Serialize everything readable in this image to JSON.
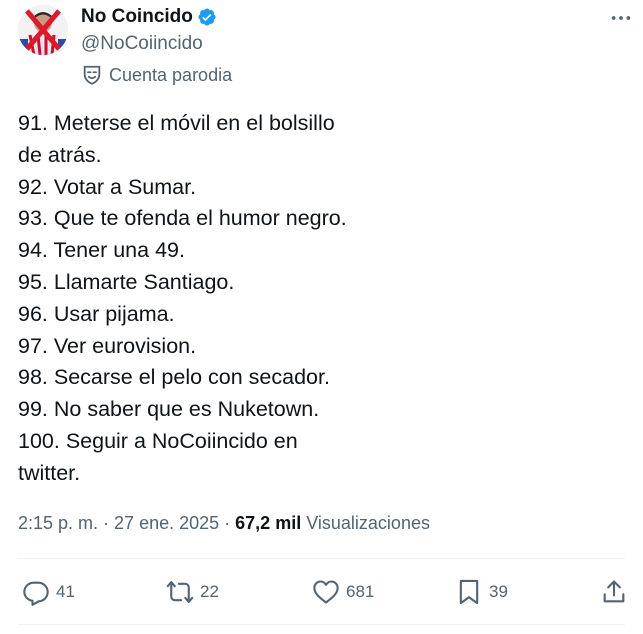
{
  "author": {
    "display_name": "No Coincido",
    "handle": "@NoCoiincido",
    "parody_label": "Cuenta parodia",
    "verified_color": "#1d9bf0"
  },
  "tweet": {
    "lines": [
      "91. Meterse el móvil en el bolsillo",
      "de atrás.",
      "92. Votar a Sumar.",
      "93. Que te ofenda el humor negro.",
      "94. Tener una 49.",
      "95. Llamarte Santiago.",
      "96. Usar pijama.",
      "97. Ver eurovision.",
      "98. Secarse el pelo con secador.",
      "99. No saber que es Nuketown.",
      "100. Seguir a NoCoiincido en",
      "twitter."
    ]
  },
  "meta": {
    "time": "2:15 p. m.",
    "separator": " · ",
    "date": "27 ene. 2025",
    "views_count": "67,2 mil",
    "views_label": "Visualizaciones"
  },
  "actions": {
    "reply_count": "41",
    "retweet_count": "22",
    "like_count": "681",
    "bookmark_count": "39"
  },
  "icons": [
    "verified-badge-icon",
    "parody-mask-icon",
    "more-icon",
    "reply-icon",
    "retweet-icon",
    "like-icon",
    "bookmark-icon",
    "share-icon"
  ],
  "colors": {
    "text": "#0f1419",
    "secondary": "#536471",
    "accent": "#1d9bf0"
  }
}
